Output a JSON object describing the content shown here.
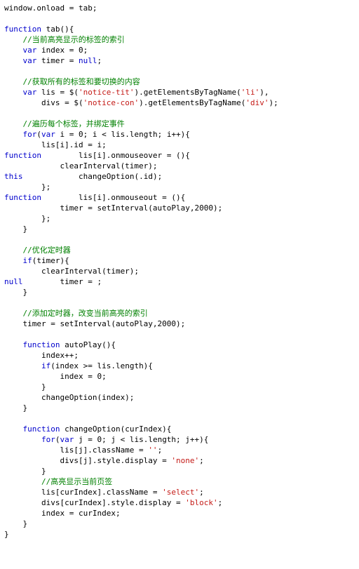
{
  "code": {
    "lines": [
      {
        "g": "window",
        "plain": ".onload = tab;"
      },
      {
        "blank": true
      },
      {
        "kw": "function",
        "plain": " tab(){"
      },
      {
        "cm": "    //当前高亮显示的标签的索引"
      },
      {
        "pre": "    ",
        "kw": "var",
        "plain": " index = 0;"
      },
      {
        "pre": "    ",
        "kw": "var",
        "plain": " timer = ",
        "kw2": "null",
        "tail": ";"
      },
      {
        "blank": true
      },
      {
        "cm": "    //获取所有的标签和要切换的内容"
      },
      {
        "pre": "    ",
        "kw": "var",
        "plain": " lis = $(",
        "s": "'notice-tit'",
        "mid": ").getElementsByTagName(",
        "s2": "'li'",
        "tail": "),"
      },
      {
        "plain": "        divs = $(",
        "s": "'notice-con'",
        "mid": ").getElementsByTagName(",
        "s2": "'div'",
        "tail": ");"
      },
      {
        "blank": true
      },
      {
        "cm": "    //遍历每个标签，并绑定事件"
      },
      {
        "pre": "    ",
        "kw": "for",
        "plain": "(",
        "kw2": "var",
        "mid": " i = 0; i < lis.length; i++){"
      },
      {
        "plain": "        lis[i].id = i;"
      },
      {
        "plain": "        lis[i].onmouseover = ",
        "kw": "function",
        "tail": "(){"
      },
      {
        "plain": "            clearInterval(timer);"
      },
      {
        "plain": "            changeOption(",
        "kw": "this",
        "tail": ".id);"
      },
      {
        "plain": "        };"
      },
      {
        "plain": "        lis[i].onmouseout = ",
        "kw": "function",
        "tail": "(){"
      },
      {
        "plain": "            timer = setInterval(autoPlay,2000);"
      },
      {
        "plain": "        };"
      },
      {
        "plain": "    }"
      },
      {
        "blank": true
      },
      {
        "cm": "    //优化定时器"
      },
      {
        "pre": "    ",
        "kw": "if",
        "plain": "(timer){"
      },
      {
        "plain": "        clearInterval(timer);"
      },
      {
        "plain": "        timer = ",
        "kw": "null",
        "tail": ";"
      },
      {
        "plain": "    }"
      },
      {
        "blank": true
      },
      {
        "cm": "    //添加定时器，改变当前高亮的索引"
      },
      {
        "plain": "    timer = setInterval(autoPlay,2000);"
      },
      {
        "blank": true
      },
      {
        "pre": "    ",
        "kw": "function",
        "plain": " autoPlay(){"
      },
      {
        "plain": "        index++;"
      },
      {
        "pre": "        ",
        "kw": "if",
        "plain": "(index >= lis.length){"
      },
      {
        "plain": "            index = 0;"
      },
      {
        "plain": "        }"
      },
      {
        "plain": "        changeOption(index);"
      },
      {
        "plain": "    }"
      },
      {
        "blank": true
      },
      {
        "pre": "    ",
        "kw": "function",
        "plain": " changeOption(curIndex){"
      },
      {
        "pre": "        ",
        "kw": "for",
        "plain": "(",
        "kw2": "var",
        "mid": " j = 0; j < lis.length; j++){"
      },
      {
        "plain": "            lis[j].className = ",
        "s": "''",
        "tail": ";"
      },
      {
        "plain": "            divs[j].style.display = ",
        "s": "'none'",
        "tail": ";"
      },
      {
        "plain": "        }"
      },
      {
        "cm": "        //高亮显示当前页签"
      },
      {
        "plain": "        lis[curIndex].className = ",
        "s": "'select'",
        "tail": ";"
      },
      {
        "plain": "        divs[curIndex].style.display = ",
        "s": "'block'",
        "tail": ";"
      },
      {
        "plain": "        index = curIndex;"
      },
      {
        "plain": "    }"
      },
      {
        "plain": "}"
      }
    ]
  }
}
